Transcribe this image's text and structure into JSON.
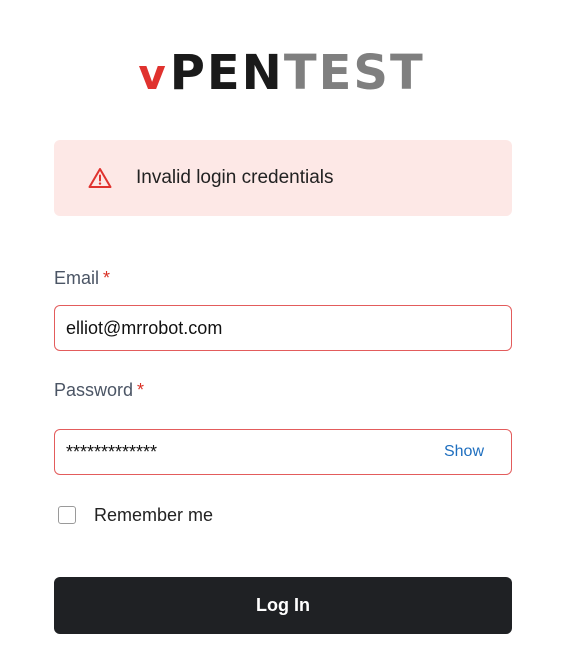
{
  "logo": {
    "part_v": "v",
    "part_pen": "PEN",
    "part_test": "TEST"
  },
  "alert": {
    "icon": "warning-triangle-icon",
    "message": "Invalid login credentials",
    "color": "#e0322e",
    "background": "#fde8e6"
  },
  "email": {
    "label": "Email",
    "required_mark": "*",
    "value": "elliot@mrrobot.com"
  },
  "password": {
    "label": "Password",
    "required_mark": "*",
    "value": "*************",
    "toggle_label": "Show"
  },
  "remember": {
    "label": "Remember me",
    "checked": false
  },
  "submit": {
    "label": "Log In"
  },
  "colors": {
    "accent_red": "#e0322e",
    "error_border": "#e35c5c",
    "link_blue": "#1f6fbf",
    "button_bg": "#1f2124"
  }
}
